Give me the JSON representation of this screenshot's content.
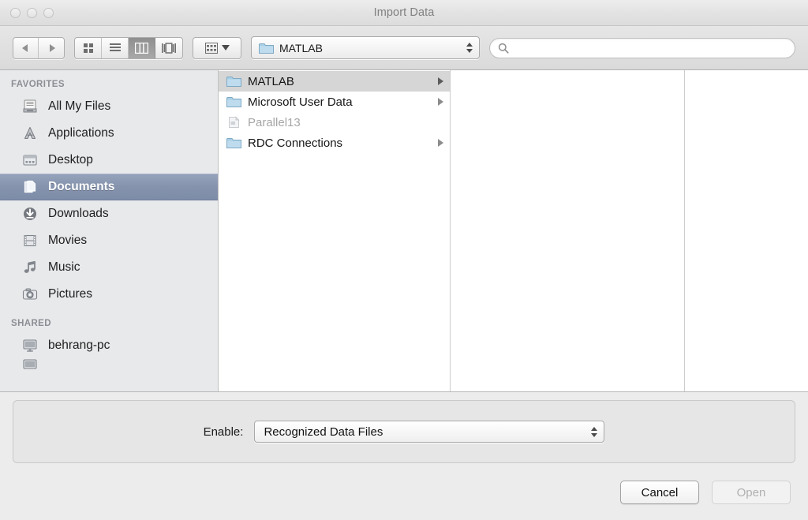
{
  "window": {
    "title": "Import Data",
    "traffic_lights": [
      "close-button",
      "minimize-button",
      "zoom-button"
    ]
  },
  "toolbar": {
    "nav": [
      {
        "name": "back-button",
        "icon": "triangle-left-icon"
      },
      {
        "name": "forward-button",
        "icon": "triangle-right-icon"
      }
    ],
    "view_modes": [
      {
        "name": "icon-view-button",
        "icon": "grid-icon",
        "selected": false
      },
      {
        "name": "list-view-button",
        "icon": "list-icon",
        "selected": false
      },
      {
        "name": "column-view-button",
        "icon": "columns-icon",
        "selected": true
      },
      {
        "name": "coverflow-view-button",
        "icon": "coverflow-icon",
        "selected": false
      }
    ],
    "arrange": {
      "name": "arrange-button",
      "icon": "arrange-grid-icon",
      "caret": "chevron-down-icon"
    },
    "path_popup": {
      "label": "MATLAB",
      "icon": "folder-icon"
    },
    "search": {
      "value": "",
      "placeholder": "",
      "icon": "search-icon"
    }
  },
  "sidebar": {
    "sections": [
      {
        "header": "FAVORITES",
        "items": [
          {
            "label": "All My Files",
            "icon": "all-my-files-icon",
            "selected": false
          },
          {
            "label": "Applications",
            "icon": "applications-icon",
            "selected": false
          },
          {
            "label": "Desktop",
            "icon": "desktop-icon",
            "selected": false
          },
          {
            "label": "Documents",
            "icon": "documents-icon",
            "selected": true
          },
          {
            "label": "Downloads",
            "icon": "downloads-icon",
            "selected": false
          },
          {
            "label": "Movies",
            "icon": "movies-icon",
            "selected": false
          },
          {
            "label": "Music",
            "icon": "music-icon",
            "selected": false
          },
          {
            "label": "Pictures",
            "icon": "pictures-icon",
            "selected": false
          }
        ]
      },
      {
        "header": "SHARED",
        "items": [
          {
            "label": "behrang-pc",
            "icon": "computer-icon",
            "selected": false
          }
        ]
      }
    ]
  },
  "file_browser": {
    "column1": [
      {
        "name": "MATLAB",
        "icon": "folder-icon",
        "selected": true,
        "disabled": false,
        "has_children": true
      },
      {
        "name": "Microsoft User Data",
        "icon": "folder-icon",
        "selected": false,
        "disabled": false,
        "has_children": true
      },
      {
        "name": "Parallel13",
        "icon": "document-icon",
        "selected": false,
        "disabled": true,
        "has_children": false
      },
      {
        "name": "RDC Connections",
        "icon": "folder-icon",
        "selected": false,
        "disabled": false,
        "has_children": true
      }
    ],
    "column2": [],
    "column3": []
  },
  "accessory": {
    "enable_label": "Enable:",
    "enable_value": "Recognized Data Files"
  },
  "footer": {
    "cancel_label": "Cancel",
    "open_label": "Open",
    "open_disabled": true
  },
  "colors": {
    "selection_blue": "#8593ad",
    "folder_blue": "#9dc6e0",
    "window_chrome": "#ececec",
    "sidebar_bg": "#e8e9eb"
  }
}
